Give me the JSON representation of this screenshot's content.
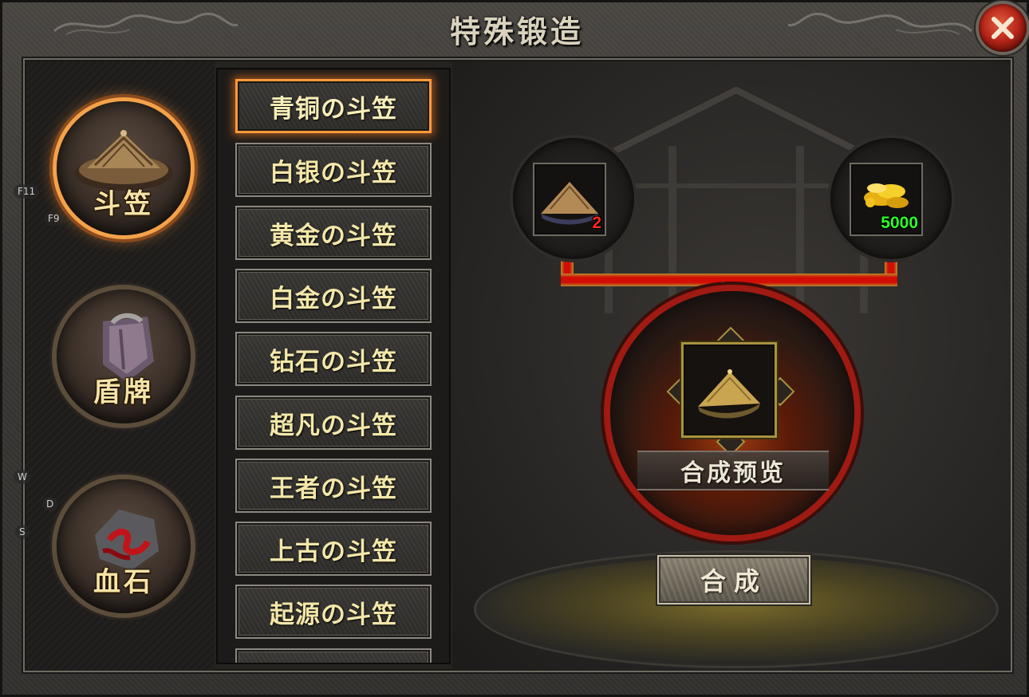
{
  "window": {
    "title": "特殊锻造",
    "close_icon": "close-icon"
  },
  "hints": [
    "F11",
    "F9",
    "W",
    "D",
    "S"
  ],
  "categories": [
    {
      "label": "斗笠",
      "icon": "hat-icon",
      "active": true
    },
    {
      "label": "盾牌",
      "icon": "shield-icon",
      "active": false
    },
    {
      "label": "血石",
      "icon": "bloodstone-icon",
      "active": false
    }
  ],
  "items": [
    {
      "label": "青铜の斗笠",
      "active": true
    },
    {
      "label": "白银の斗笠",
      "active": false
    },
    {
      "label": "黄金の斗笠",
      "active": false
    },
    {
      "label": "白金の斗笠",
      "active": false
    },
    {
      "label": "钻石の斗笠",
      "active": false
    },
    {
      "label": "超凡の斗笠",
      "active": false
    },
    {
      "label": "王者の斗笠",
      "active": false
    },
    {
      "label": "上古の斗笠",
      "active": false
    },
    {
      "label": "起源の斗笠",
      "active": false
    }
  ],
  "materials": [
    {
      "icon": "straw-hat-icon",
      "count": "2",
      "count_color": "#ff2a1a"
    },
    {
      "icon": "gold-coins-icon",
      "count": "5000",
      "count_color": "#2bff2b"
    }
  ],
  "result": {
    "icon": "bronze-hat-icon",
    "label": "合成预览"
  },
  "forge_button": {
    "label": "合成"
  }
}
